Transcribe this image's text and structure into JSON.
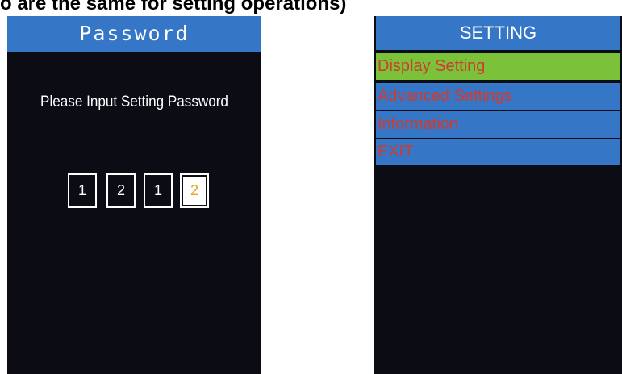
{
  "caption": "o are the same for setting operations)",
  "password_screen": {
    "title": "Password",
    "prompt": "Please Input Setting Password",
    "digits": [
      "1",
      "2",
      "1",
      "2"
    ],
    "active_digit_index": 3
  },
  "setting_screen": {
    "title": "SETTING",
    "menu_items": [
      "Display Setting",
      "Advanced Settings",
      "Information",
      "EXIT"
    ],
    "selected_index": 0
  },
  "colors": {
    "header_blue": "#3576c6",
    "selected_green": "#7bc23a",
    "menu_text_red": "#d03b30",
    "active_digit_orange": "#e8a41a",
    "screen_background": "#0b0c14"
  }
}
